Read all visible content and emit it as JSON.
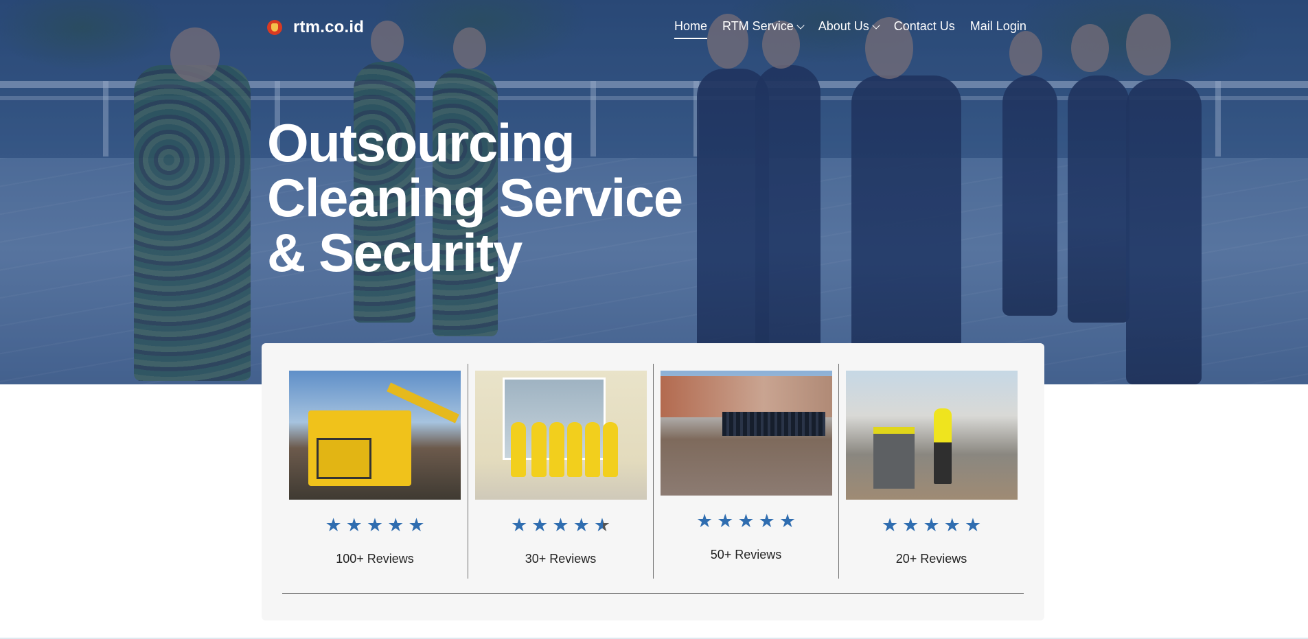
{
  "brand": {
    "name": "rtm.co.id"
  },
  "nav": {
    "items": [
      {
        "label": "Home",
        "active": true,
        "dropdown": false
      },
      {
        "label": "RTM Service",
        "active": false,
        "dropdown": true
      },
      {
        "label": "About Us",
        "active": false,
        "dropdown": true
      },
      {
        "label": "Contact Us",
        "active": false,
        "dropdown": false
      },
      {
        "label": "Mail Login",
        "active": false,
        "dropdown": false
      }
    ]
  },
  "hero": {
    "lines": [
      "Outsourcing",
      "Cleaning Service",
      "& Security"
    ]
  },
  "services": [
    {
      "image": "dump-truck-photo",
      "rating": 5,
      "reviews": "100+ Reviews"
    },
    {
      "image": "cleaning-staff-photo",
      "rating": 4.5,
      "reviews": "30+ Reviews"
    },
    {
      "image": "security-team-photo",
      "rating": 5,
      "reviews": "50+ Reviews"
    },
    {
      "image": "street-cleaner-photo",
      "rating": 5,
      "reviews": "20+ Reviews"
    }
  ],
  "colors": {
    "star": "#2f6db0",
    "hero_overlay": "#2a4a72"
  }
}
